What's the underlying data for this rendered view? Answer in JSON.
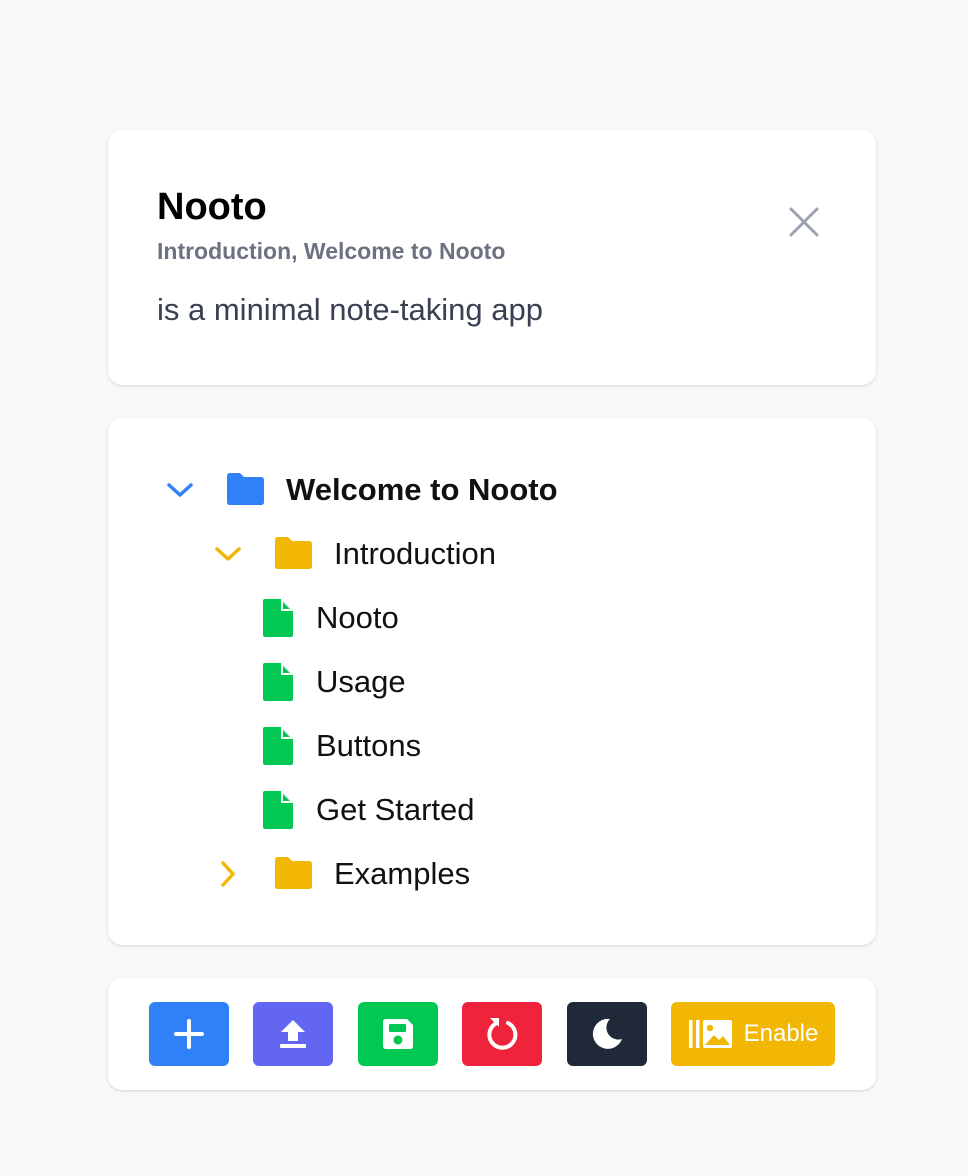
{
  "note": {
    "title": "Nooto",
    "breadcrumb": "Introduction, Welcome to Nooto",
    "body": "is a minimal note-taking app",
    "close_icon": "close-icon"
  },
  "tree": {
    "root": {
      "label": "Welcome to Nooto",
      "expanded": true,
      "icon": "folder-icon",
      "color": "#3b82f6"
    },
    "folders": [
      {
        "label": "Introduction",
        "expanded": true,
        "icon": "folder-icon",
        "color": "#f2b705",
        "files": [
          "Nooto",
          "Usage",
          "Buttons",
          "Get Started"
        ]
      },
      {
        "label": "Examples",
        "expanded": false,
        "icon": "folder-icon",
        "color": "#f2b705"
      }
    ],
    "file_color": "#00c853"
  },
  "toolbar": {
    "buttons": [
      {
        "name": "add-note-button",
        "icon": "plus-icon",
        "color": "#3080f8"
      },
      {
        "name": "upload-button",
        "icon": "upload-icon",
        "color": "#6366f1"
      },
      {
        "name": "save-button",
        "icon": "floppy-disk-icon",
        "color": "#00c853"
      },
      {
        "name": "reset-button",
        "icon": "rotate-icon",
        "color": "#ef233c"
      },
      {
        "name": "dark-mode-button",
        "icon": "moon-icon",
        "color": "#1f2937"
      },
      {
        "name": "enable-images-button",
        "icon": "image-library-icon",
        "color": "#f2b705",
        "label": "Enable"
      }
    ]
  }
}
